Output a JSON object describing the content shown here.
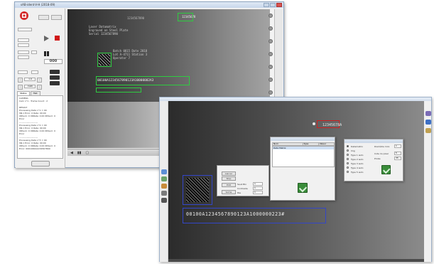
{
  "main_window": {
    "title": "sAB-ident-V-H (2018-09)",
    "viewer": {
      "top_code": "12345678",
      "ocr_header": "1234567890",
      "ocr_lines": [
        "Laser Datamatrix",
        "Engraved on Steel Plate",
        "Serial 1234567890",
        "Batch 0815 Date 2018",
        "Lot A-4711 Station 3",
        "Operator 7"
      ],
      "strip_text": "00100A1234567890123A10000002A3",
      "tool_labels": [
        "◀",
        "▮▮",
        "▢"
      ],
      "camera_label": "Camera n°1"
    },
    "left_panel": {
      "tab_labels": [
        "Status",
        "Hist."
      ],
      "status_lines": [
        "CAMERA",
        "Cam n°1 - Trame Count : 2",
        "",
        "RESULT",
        "Processing Data n°1 = 00",
        "  SN:1  Error: 0  Rate: 00:00",
        "  XRSum: 0  XRRate: 0.00  XRSum: 0",
        "  Error",
        "  ------------------------",
        "Processing Data n°2 = 00",
        "  SN:1  Error: 0  Rate: 00:00",
        "  XRSum: 0  XRRate: 0.00  XRSum: 0",
        "  Error",
        "  ------------------------",
        "Processing Data n°3 = 00",
        "  SN:1  Error: 0  Rate: 00:00",
        "  XRSum: 0  XRRate: 0.00  XRSum: 0",
        "  Error: 0001000A1234567890"
      ],
      "counter_value": "000",
      "zoom_value": "1.0",
      "calib_label": "Calib"
    }
  },
  "second_window": {
    "top_code": "12345678A",
    "dm_text": "00100A1234567890123A1000000223#",
    "dialog_left": {
      "buttons": [
        "Lancer",
        "Stop",
        "Edit",
        "Sortie"
      ],
      "field_labels": [
        "Seuil Bin",
        "Contraste",
        "Pas"
      ],
      "field_values": [
        "1",
        "1",
        "1"
      ]
    },
    "dialog_mid": {
      "col_headers": [
        "Nom",
        "Type",
        "Valeur"
      ],
      "first_row": "Data Matrix"
    },
    "dialog_right": {
      "options": [
        "Datamatrix",
        "Img",
        "Type 1 auto",
        "Type 2 auto",
        "Type 3 auto",
        "Type 4 auto",
        "Type 5 auto"
      ],
      "labels": [
        "Diamètre mini",
        "Cote du pixel",
        "Proba"
      ],
      "values": [
        "1",
        "5",
        "35"
      ]
    }
  }
}
